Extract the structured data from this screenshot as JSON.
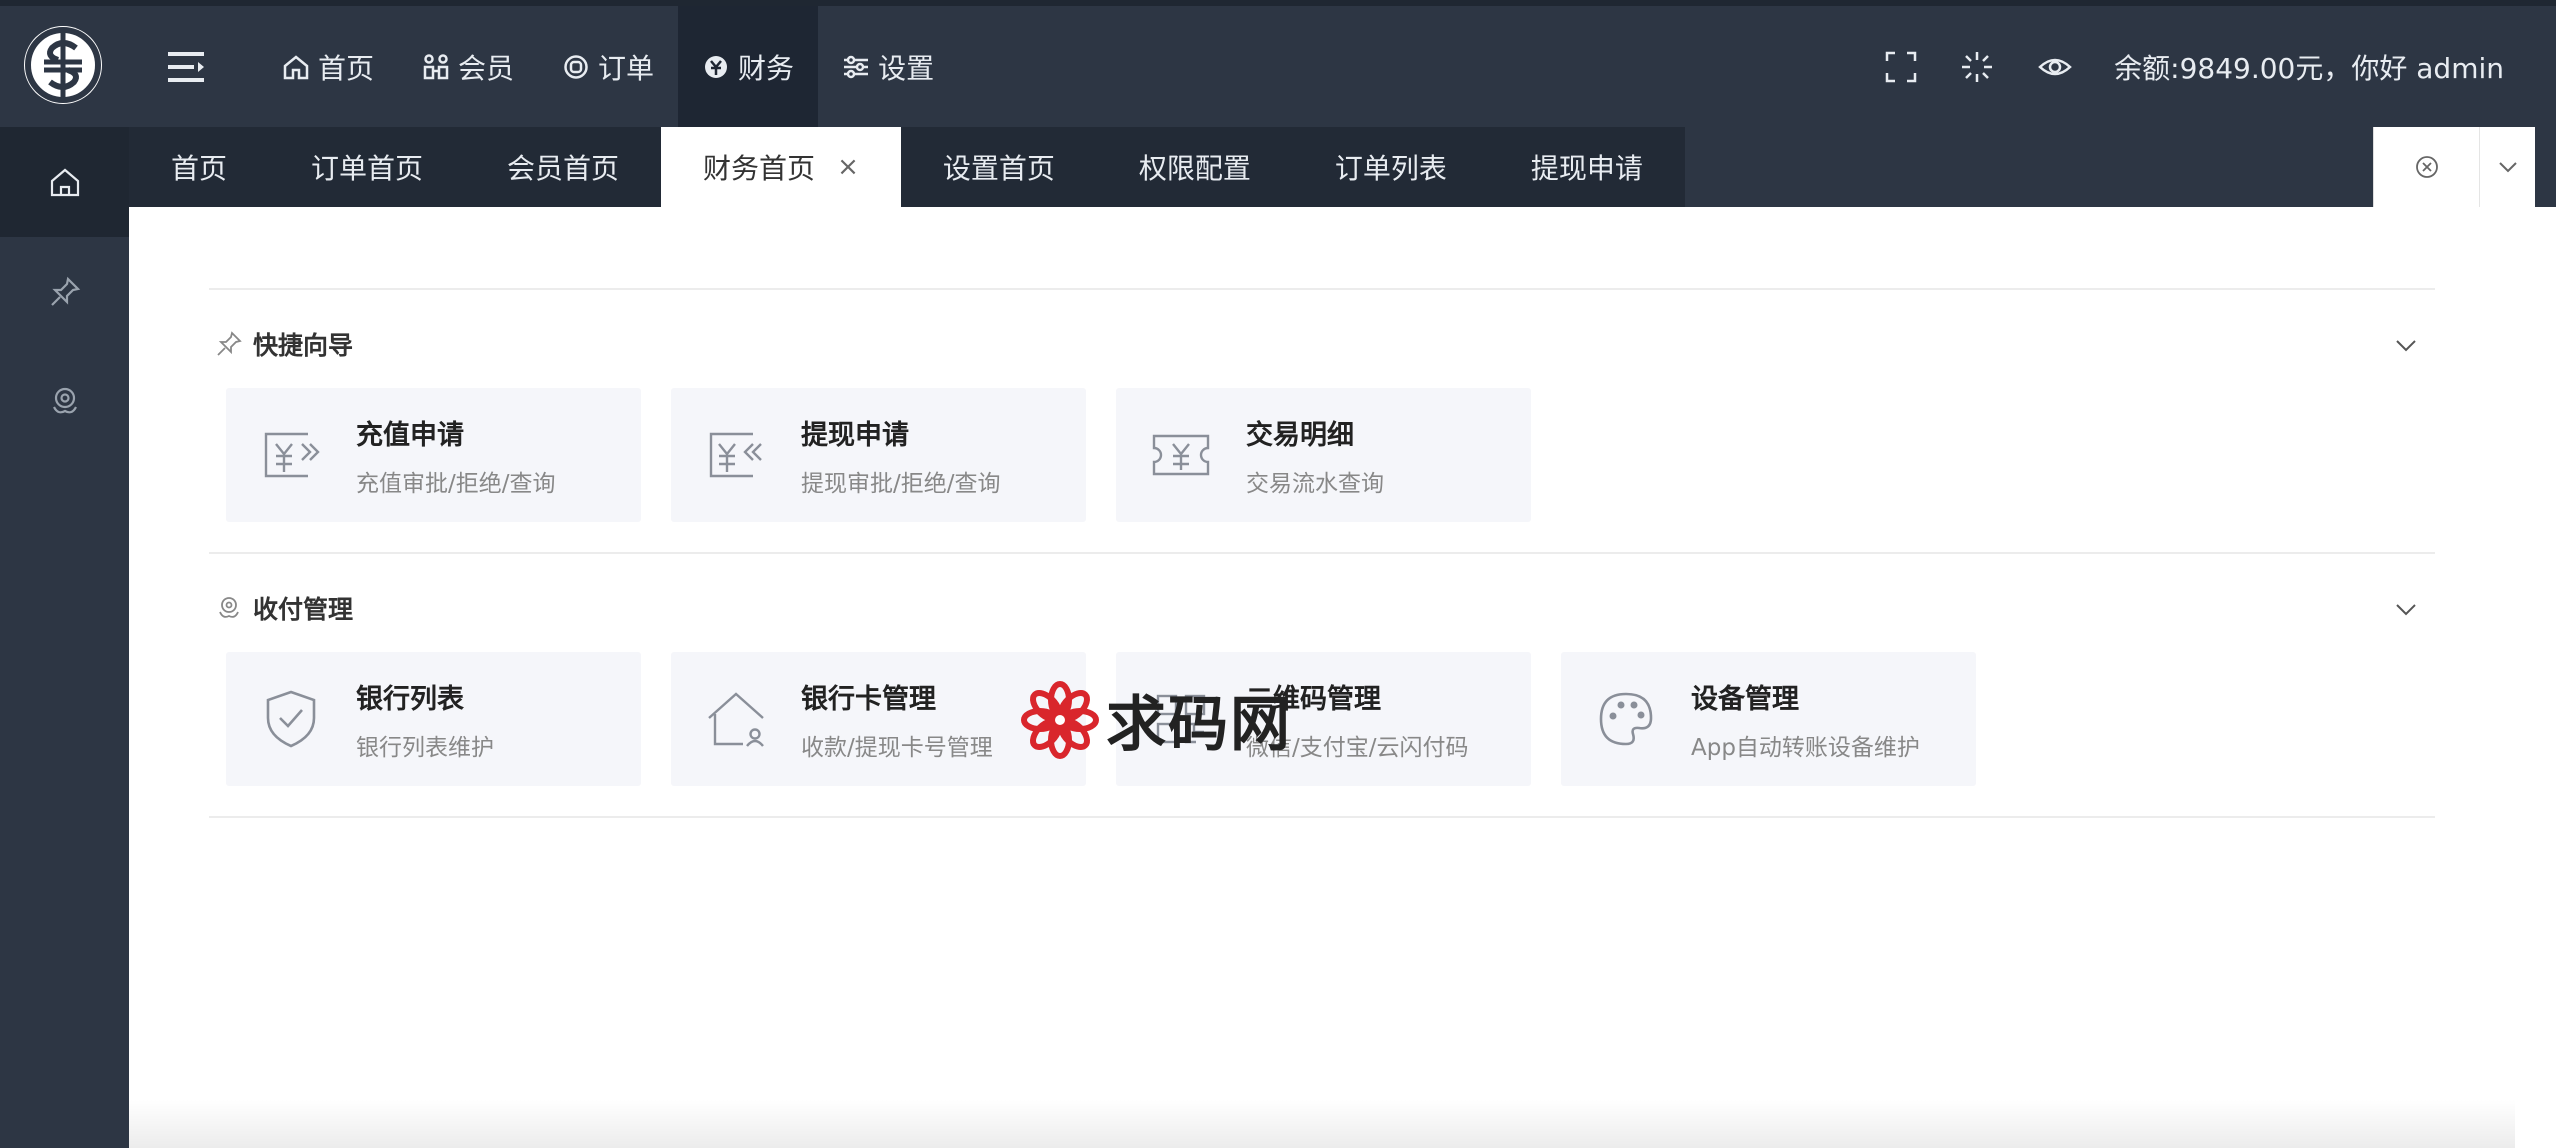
{
  "header": {
    "nav": [
      {
        "label": "首页",
        "icon": "home-icon"
      },
      {
        "label": "会员",
        "icon": "members-icon"
      },
      {
        "label": "订单",
        "icon": "order-icon"
      },
      {
        "label": "财务",
        "icon": "finance-icon",
        "active": true
      },
      {
        "label": "设置",
        "icon": "settings-icon"
      }
    ],
    "greeting": "余额:9849.00元，你好 admin"
  },
  "tabs": [
    {
      "label": "首页"
    },
    {
      "label": "订单首页"
    },
    {
      "label": "会员首页"
    },
    {
      "label": "财务首页",
      "active": true,
      "close": "×"
    },
    {
      "label": "设置首页"
    },
    {
      "label": "权限配置"
    },
    {
      "label": "订单列表"
    },
    {
      "label": "提现申请"
    }
  ],
  "sections": [
    {
      "title": "快捷向导",
      "icon": "pin-icon",
      "cards": [
        {
          "title": "充值申请",
          "desc": "充值审批/拒绝/查询",
          "icon": "recharge-icon"
        },
        {
          "title": "提现申请",
          "desc": "提现审批/拒绝/查询",
          "icon": "withdraw-icon"
        },
        {
          "title": "交易明细",
          "desc": "交易流水查询",
          "icon": "ticket-icon"
        }
      ]
    },
    {
      "title": "收付管理",
      "icon": "payment-icon",
      "cards": [
        {
          "title": "银行列表",
          "desc": "银行列表维护",
          "icon": "shield-check-icon"
        },
        {
          "title": "银行卡管理",
          "desc": "收款/提现卡号管理",
          "icon": "house-user-icon"
        },
        {
          "title": "二维码管理",
          "desc": "微信/支付宝/云闪付码",
          "icon": "qrcode-icon"
        },
        {
          "title": "设备管理",
          "desc": "App自动转账设备维护",
          "icon": "palette-icon"
        }
      ]
    }
  ],
  "watermark": {
    "text": "求码网"
  },
  "colors": {
    "header_bg": "#2d3644",
    "active_bg": "#1e2633",
    "card_bg": "#f5f6fa",
    "watermark_red": "#d9262c"
  }
}
